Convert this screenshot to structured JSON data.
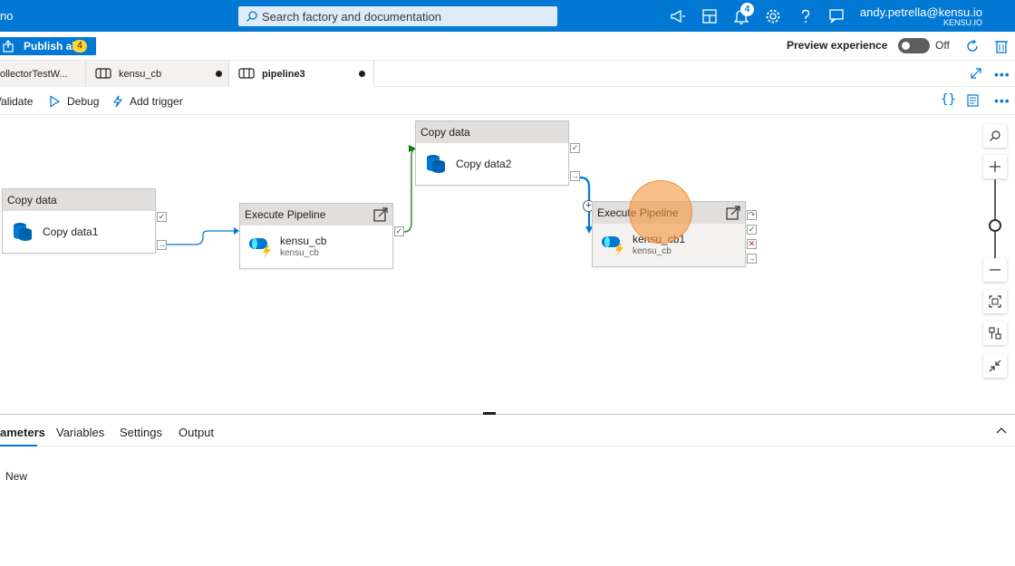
{
  "topbar": {
    "brand": "no",
    "search_placeholder": "Search factory and documentation",
    "notification_count": "4",
    "user_email": "andy.petrella@kensu.io",
    "user_org": "KENSU.IO"
  },
  "actions": {
    "publish_label": "Publish all",
    "publish_count": "4",
    "preview_label": "Preview experience",
    "preview_state": "Off"
  },
  "tabs": [
    {
      "label": "ollectorTestW..."
    },
    {
      "label": "kensu_cb"
    },
    {
      "label": "pipeline3"
    }
  ],
  "toolbar": {
    "validate": "Validate",
    "debug": "Debug",
    "add_trigger": "Add trigger"
  },
  "canvas": {
    "nodes": [
      {
        "type": "Copy data",
        "name": "Copy data1",
        "sub": ""
      },
      {
        "type": "Execute Pipeline",
        "name": "kensu_cb",
        "sub": "kensu_cb"
      },
      {
        "type": "Copy data",
        "name": "Copy data2",
        "sub": ""
      },
      {
        "type": "Execute Pipeline",
        "name": "kensu_cb1",
        "sub": "kensu_cb"
      }
    ]
  },
  "bottom_panel": {
    "tabs": [
      "ameters",
      "Variables",
      "Settings",
      "Output"
    ],
    "new_label": "New"
  },
  "colors": {
    "brand": "#0078d4",
    "success": "#107c10",
    "failure": "#a4262c",
    "highlight": "#f7943c"
  }
}
